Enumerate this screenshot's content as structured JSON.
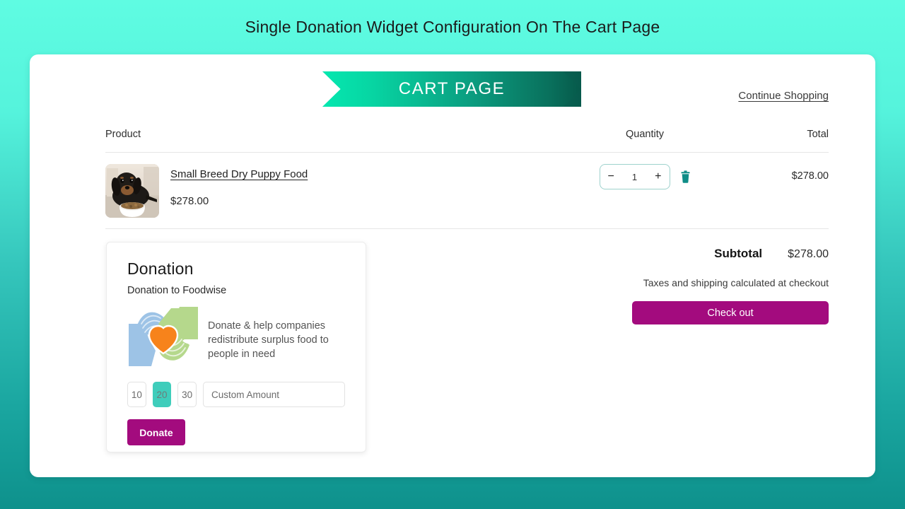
{
  "page": {
    "title": "Single Donation Widget Configuration On The Cart Page",
    "background_top_color": "#5FFCE2",
    "background_bottom_color": "#0E918C"
  },
  "header": {
    "ribbon_label": "CART PAGE",
    "continue_shopping_label": "Continue Shopping",
    "ribbon_gradient_from": "#05E8B0",
    "ribbon_gradient_to": "#06594A"
  },
  "cart_table": {
    "columns": {
      "product": "Product",
      "quantity": "Quantity",
      "total": "Total"
    },
    "rows": [
      {
        "name": "Small Breed Dry Puppy Food",
        "price": "$278.00",
        "quantity": "1",
        "total": "$278.00",
        "thumbnail": "puppy-eating-from-bowl",
        "decrease_label": "−",
        "increase_label": "+",
        "remove_icon": "trash-icon"
      }
    ]
  },
  "donation_widget": {
    "title": "Donation",
    "subtitle": "Donation to Foodwise",
    "description": "Donate & help companies redistribute surplus food to people in need",
    "logo_icon": "hands-holding-heart-icon",
    "logo_colors": {
      "left_hand": "#9DC3E6",
      "right_hand": "#B5D88C",
      "heart": "#F7831B"
    },
    "amount_options": [
      {
        "label": "10",
        "selected": false
      },
      {
        "label": "20",
        "selected": true
      },
      {
        "label": "30",
        "selected": false
      }
    ],
    "custom_amount_placeholder": "Custom Amount",
    "custom_amount_value": "",
    "donate_label": "Donate",
    "selected_color": "#3FCDBB",
    "donate_color": "#A30B7E"
  },
  "summary": {
    "subtotal_label": "Subtotal",
    "subtotal_value": "$278.00",
    "note": "Taxes and shipping calculated at checkout",
    "checkout_label": "Check out",
    "checkout_color": "#A30B7E"
  }
}
